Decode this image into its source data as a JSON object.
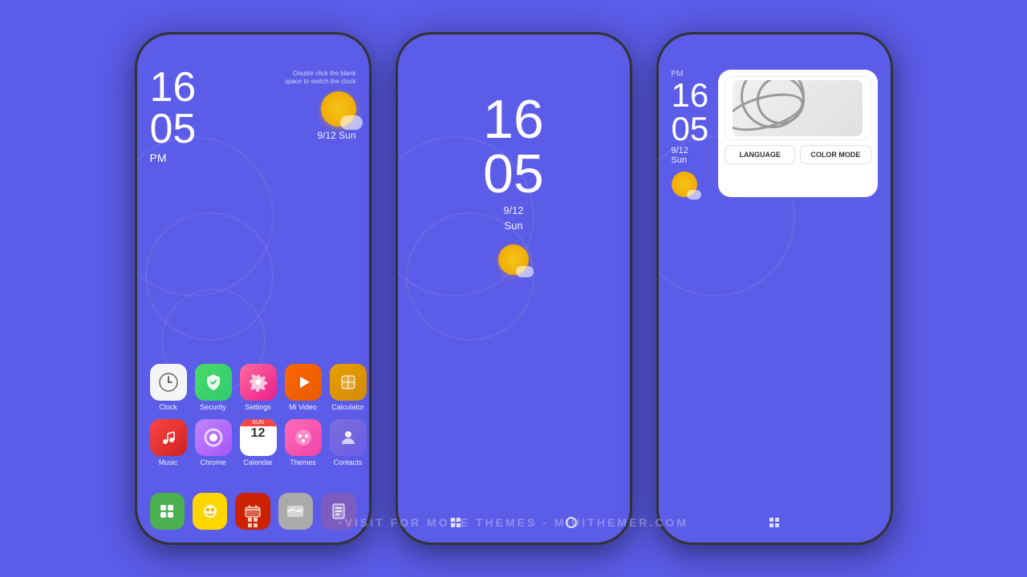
{
  "background": {
    "color": "#5b5ce8"
  },
  "watermark": {
    "text": "·VISIT FOR MORE THEMES - MIUITHEMER.COM"
  },
  "phone1": {
    "hint": "·Double click the blank space to switch the clock",
    "time": "16\n05",
    "time_hours": "16",
    "time_minutes": "05",
    "ampm": "PM",
    "date": "9/12  Sun",
    "apps_row1": [
      {
        "name": "Clock",
        "icon": "clock"
      },
      {
        "name": "Security",
        "icon": "security"
      },
      {
        "name": "Settings",
        "icon": "settings"
      },
      {
        "name": "Mi Video",
        "icon": "mivideo"
      },
      {
        "name": "Calculator",
        "icon": "calculator"
      }
    ],
    "apps_row2": [
      {
        "name": "Music",
        "icon": "music"
      },
      {
        "name": "Chrome",
        "icon": "chrome"
      },
      {
        "name": "Calendar",
        "icon": "calendar"
      },
      {
        "name": "Themes",
        "icon": "themes"
      },
      {
        "name": "Contacts",
        "icon": "contacts"
      }
    ]
  },
  "phone2": {
    "time_hours": "16",
    "time_minutes": "05",
    "date_line1": "9/12",
    "date_line2": "Sun"
  },
  "phone3": {
    "time_hours": "16",
    "time_minutes": "05",
    "ampm": "PM",
    "date_line1": "9/12",
    "date_line2": "Sun",
    "btn_language": "LANGUAGE",
    "btn_color_mode": "COLOR MODE"
  }
}
